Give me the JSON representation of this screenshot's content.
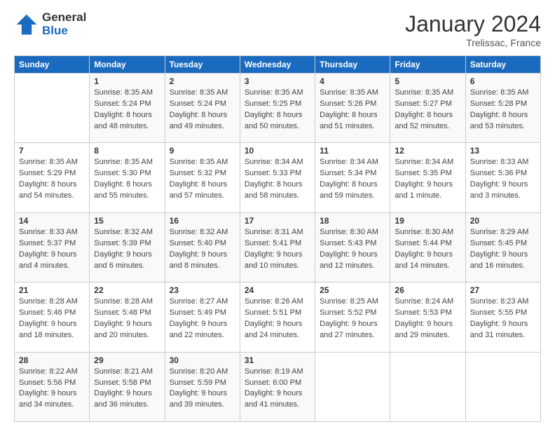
{
  "logo": {
    "general": "General",
    "blue": "Blue"
  },
  "header": {
    "month": "January 2024",
    "location": "Trelissac, France"
  },
  "days_of_week": [
    "Sunday",
    "Monday",
    "Tuesday",
    "Wednesday",
    "Thursday",
    "Friday",
    "Saturday"
  ],
  "weeks": [
    [
      {
        "day": "",
        "sunrise": "",
        "sunset": "",
        "daylight": ""
      },
      {
        "day": "1",
        "sunrise": "Sunrise: 8:35 AM",
        "sunset": "Sunset: 5:24 PM",
        "daylight": "Daylight: 8 hours and 48 minutes."
      },
      {
        "day": "2",
        "sunrise": "Sunrise: 8:35 AM",
        "sunset": "Sunset: 5:24 PM",
        "daylight": "Daylight: 8 hours and 49 minutes."
      },
      {
        "day": "3",
        "sunrise": "Sunrise: 8:35 AM",
        "sunset": "Sunset: 5:25 PM",
        "daylight": "Daylight: 8 hours and 50 minutes."
      },
      {
        "day": "4",
        "sunrise": "Sunrise: 8:35 AM",
        "sunset": "Sunset: 5:26 PM",
        "daylight": "Daylight: 8 hours and 51 minutes."
      },
      {
        "day": "5",
        "sunrise": "Sunrise: 8:35 AM",
        "sunset": "Sunset: 5:27 PM",
        "daylight": "Daylight: 8 hours and 52 minutes."
      },
      {
        "day": "6",
        "sunrise": "Sunrise: 8:35 AM",
        "sunset": "Sunset: 5:28 PM",
        "daylight": "Daylight: 8 hours and 53 minutes."
      }
    ],
    [
      {
        "day": "7",
        "sunrise": "Sunrise: 8:35 AM",
        "sunset": "Sunset: 5:29 PM",
        "daylight": "Daylight: 8 hours and 54 minutes."
      },
      {
        "day": "8",
        "sunrise": "Sunrise: 8:35 AM",
        "sunset": "Sunset: 5:30 PM",
        "daylight": "Daylight: 8 hours and 55 minutes."
      },
      {
        "day": "9",
        "sunrise": "Sunrise: 8:35 AM",
        "sunset": "Sunset: 5:32 PM",
        "daylight": "Daylight: 8 hours and 57 minutes."
      },
      {
        "day": "10",
        "sunrise": "Sunrise: 8:34 AM",
        "sunset": "Sunset: 5:33 PM",
        "daylight": "Daylight: 8 hours and 58 minutes."
      },
      {
        "day": "11",
        "sunrise": "Sunrise: 8:34 AM",
        "sunset": "Sunset: 5:34 PM",
        "daylight": "Daylight: 8 hours and 59 minutes."
      },
      {
        "day": "12",
        "sunrise": "Sunrise: 8:34 AM",
        "sunset": "Sunset: 5:35 PM",
        "daylight": "Daylight: 9 hours and 1 minute."
      },
      {
        "day": "13",
        "sunrise": "Sunrise: 8:33 AM",
        "sunset": "Sunset: 5:36 PM",
        "daylight": "Daylight: 9 hours and 3 minutes."
      }
    ],
    [
      {
        "day": "14",
        "sunrise": "Sunrise: 8:33 AM",
        "sunset": "Sunset: 5:37 PM",
        "daylight": "Daylight: 9 hours and 4 minutes."
      },
      {
        "day": "15",
        "sunrise": "Sunrise: 8:32 AM",
        "sunset": "Sunset: 5:39 PM",
        "daylight": "Daylight: 9 hours and 6 minutes."
      },
      {
        "day": "16",
        "sunrise": "Sunrise: 8:32 AM",
        "sunset": "Sunset: 5:40 PM",
        "daylight": "Daylight: 9 hours and 8 minutes."
      },
      {
        "day": "17",
        "sunrise": "Sunrise: 8:31 AM",
        "sunset": "Sunset: 5:41 PM",
        "daylight": "Daylight: 9 hours and 10 minutes."
      },
      {
        "day": "18",
        "sunrise": "Sunrise: 8:30 AM",
        "sunset": "Sunset: 5:43 PM",
        "daylight": "Daylight: 9 hours and 12 minutes."
      },
      {
        "day": "19",
        "sunrise": "Sunrise: 8:30 AM",
        "sunset": "Sunset: 5:44 PM",
        "daylight": "Daylight: 9 hours and 14 minutes."
      },
      {
        "day": "20",
        "sunrise": "Sunrise: 8:29 AM",
        "sunset": "Sunset: 5:45 PM",
        "daylight": "Daylight: 9 hours and 16 minutes."
      }
    ],
    [
      {
        "day": "21",
        "sunrise": "Sunrise: 8:28 AM",
        "sunset": "Sunset: 5:46 PM",
        "daylight": "Daylight: 9 hours and 18 minutes."
      },
      {
        "day": "22",
        "sunrise": "Sunrise: 8:28 AM",
        "sunset": "Sunset: 5:48 PM",
        "daylight": "Daylight: 9 hours and 20 minutes."
      },
      {
        "day": "23",
        "sunrise": "Sunrise: 8:27 AM",
        "sunset": "Sunset: 5:49 PM",
        "daylight": "Daylight: 9 hours and 22 minutes."
      },
      {
        "day": "24",
        "sunrise": "Sunrise: 8:26 AM",
        "sunset": "Sunset: 5:51 PM",
        "daylight": "Daylight: 9 hours and 24 minutes."
      },
      {
        "day": "25",
        "sunrise": "Sunrise: 8:25 AM",
        "sunset": "Sunset: 5:52 PM",
        "daylight": "Daylight: 9 hours and 27 minutes."
      },
      {
        "day": "26",
        "sunrise": "Sunrise: 8:24 AM",
        "sunset": "Sunset: 5:53 PM",
        "daylight": "Daylight: 9 hours and 29 minutes."
      },
      {
        "day": "27",
        "sunrise": "Sunrise: 8:23 AM",
        "sunset": "Sunset: 5:55 PM",
        "daylight": "Daylight: 9 hours and 31 minutes."
      }
    ],
    [
      {
        "day": "28",
        "sunrise": "Sunrise: 8:22 AM",
        "sunset": "Sunset: 5:56 PM",
        "daylight": "Daylight: 9 hours and 34 minutes."
      },
      {
        "day": "29",
        "sunrise": "Sunrise: 8:21 AM",
        "sunset": "Sunset: 5:58 PM",
        "daylight": "Daylight: 9 hours and 36 minutes."
      },
      {
        "day": "30",
        "sunrise": "Sunrise: 8:20 AM",
        "sunset": "Sunset: 5:59 PM",
        "daylight": "Daylight: 9 hours and 39 minutes."
      },
      {
        "day": "31",
        "sunrise": "Sunrise: 8:19 AM",
        "sunset": "Sunset: 6:00 PM",
        "daylight": "Daylight: 9 hours and 41 minutes."
      },
      {
        "day": "",
        "sunrise": "",
        "sunset": "",
        "daylight": ""
      },
      {
        "day": "",
        "sunrise": "",
        "sunset": "",
        "daylight": ""
      },
      {
        "day": "",
        "sunrise": "",
        "sunset": "",
        "daylight": ""
      }
    ]
  ]
}
